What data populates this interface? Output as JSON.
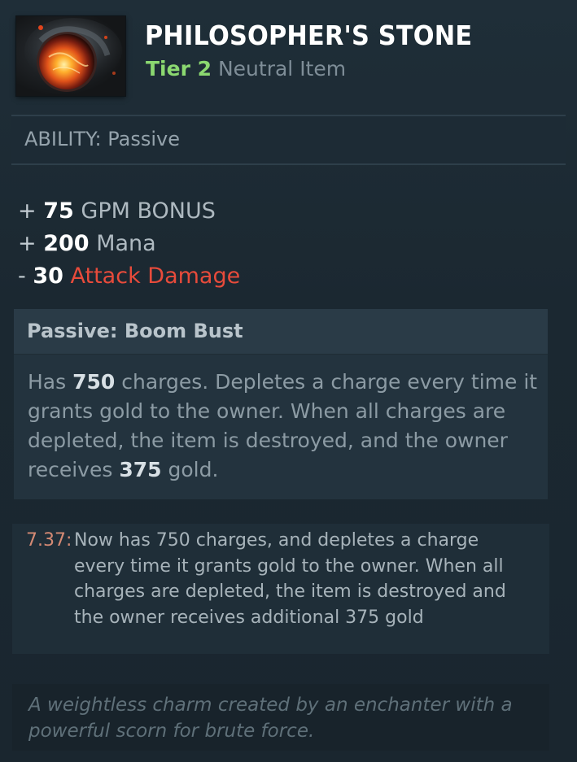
{
  "item": {
    "title": "PHILOSOPHER'S STONE",
    "tier": "Tier 2",
    "type": "Neutral Item",
    "icon": "philosophers-stone-icon"
  },
  "ability": {
    "label": "ABILITY: Passive"
  },
  "stats": [
    {
      "sign": "+",
      "value": "75",
      "name": "GPM BONUS",
      "negative": false
    },
    {
      "sign": "+",
      "value": "200",
      "name": "Mana",
      "negative": false
    },
    {
      "sign": "-",
      "value": "30",
      "name": "Attack Damage",
      "negative": true
    }
  ],
  "passive": {
    "title": "Passive: Boom Bust",
    "text_1": "Has ",
    "charges": "750",
    "text_2": " charges. Depletes a charge every time it grants gold to the owner. When all charges are depleted, the item is destroyed, and the owner receives ",
    "gold": "375",
    "text_3": " gold."
  },
  "patch_note": {
    "version": "7.37:",
    "text": "Now has 750 charges, and depletes a charge every time it grants gold to the owner. When all charges are depleted, the item is destroyed and the owner receives additional 375 gold"
  },
  "lore": {
    "text": "A weightless charm created by an enchanter with a powerful scorn for brute force."
  },
  "colors": {
    "tier": "#8bd870",
    "negative_stat": "#e84b3b",
    "patch_version": "#d58a74",
    "background": "#1a262f"
  }
}
